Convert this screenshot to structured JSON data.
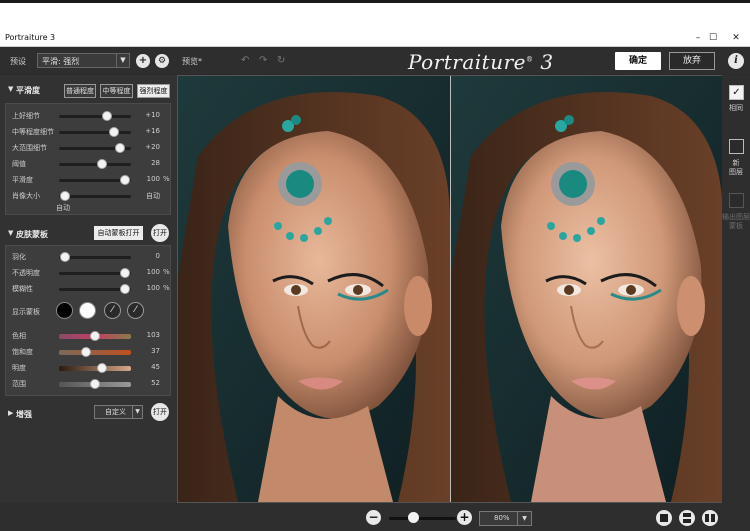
{
  "window": {
    "title": "Portraiture 3",
    "controls": [
      "–",
      "☐",
      "✕"
    ]
  },
  "toolbar": {
    "preset_label": "预设",
    "preset_value": "平滑: 强烈",
    "preview_label": "预览*",
    "logo": "Portraiture",
    "logo_reg": "®",
    "logo_version": "3",
    "ok_label": "确定",
    "cancel_label": "放弃",
    "info_label": "i",
    "add_icon": "plus-icon",
    "settings_icon": "gear-icon"
  },
  "smoothing": {
    "title": "平滑度",
    "levels": [
      "普通程度",
      "中等程度",
      "强烈程度"
    ],
    "active_level": 2,
    "sliders": [
      {
        "label": "上好细节",
        "value": "+10",
        "unit": "",
        "fraction": 0.7
      },
      {
        "label": "中等程度细节",
        "value": "+16",
        "unit": "",
        "fraction": 0.8
      },
      {
        "label": "大范围细节",
        "value": "+20",
        "unit": "",
        "fraction": 0.9
      },
      {
        "label": "阈值",
        "value": "28",
        "unit": "",
        "fraction": 0.62
      },
      {
        "label": "平滑度",
        "value": "100",
        "unit": "%",
        "fraction": 0.98
      },
      {
        "label": "肖像大小",
        "value": "自动",
        "unit": "",
        "fraction": 0.02
      }
    ],
    "auto_note": "自动"
  },
  "skin_mask": {
    "title": "皮肤蒙板",
    "auto_mask_label": "自动蒙板打开",
    "open_label": "打开",
    "sliders": [
      {
        "label": "羽化",
        "value": "0",
        "unit": "",
        "fraction": 0.02
      },
      {
        "label": "不透明度",
        "value": "100",
        "unit": "%",
        "fraction": 0.98
      },
      {
        "label": "模糊性",
        "value": "100",
        "unit": "%",
        "fraction": 0.98
      }
    ],
    "show_mask_label": "显示蒙板",
    "color_sliders": [
      {
        "label": "色相",
        "value": "103",
        "fraction": 0.5
      },
      {
        "label": "饱和度",
        "value": "37",
        "fraction": 0.36
      },
      {
        "label": "明度",
        "value": "45",
        "fraction": 0.62
      },
      {
        "label": "范围",
        "value": "52",
        "fraction": 0.5
      }
    ]
  },
  "enhance": {
    "title": "增强",
    "select_value": "自定义",
    "open_label": "打开"
  },
  "rightbar": {
    "items": [
      {
        "label": "相同",
        "checked": true
      },
      {
        "label": "新\n图层",
        "checked": false
      },
      {
        "label": "输出图层\n蒙板",
        "checked": false
      }
    ]
  },
  "bottom": {
    "zoom_value": "80%",
    "zoom_out": "−",
    "zoom_in": "+",
    "zoom_fraction": 0.3
  },
  "colors": {
    "panel": "#323232",
    "accent_white": "#ffffff",
    "hue_gradient": [
      "#8a4a6a",
      "#c04060",
      "#8a7a4a"
    ],
    "sat_gradient": [
      "#7a6a5a",
      "#c05020"
    ],
    "light_gradient": [
      "#2a1a10",
      "#d8a888"
    ],
    "range_gradient": [
      "#555555",
      "#999999"
    ]
  }
}
